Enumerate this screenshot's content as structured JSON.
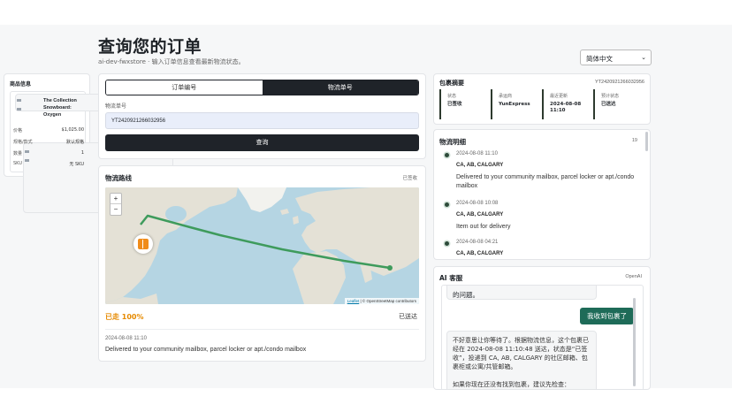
{
  "header": {
    "title": "查询您的订单",
    "subtitle": "ai-dev-fwxstore · 输入订单信息查看最新物流状态。",
    "language": "简体中文"
  },
  "product": {
    "section_title": "商品信息",
    "name": "The Collection Snowboard: Oxygen",
    "rows": [
      {
        "label": "价格",
        "value": "$1,025.00"
      },
      {
        "label": "规格/款式",
        "value": "默认规格"
      },
      {
        "label": "数量",
        "value": "1"
      },
      {
        "label": "SKU",
        "value": "无 SKU"
      }
    ]
  },
  "search": {
    "tabs": [
      "订单编号",
      "物流单号"
    ],
    "active_tab": "物流单号",
    "field_label": "物流单号",
    "field_value": "YT2420921266032956",
    "submit_label": "查询"
  },
  "route": {
    "title": "物流路线",
    "tag": "已签收",
    "attribution_link": "Leaflet",
    "attribution_text": " | © OpenStreetMap contributors",
    "progress_label": "已走 100%",
    "progress_fraction": 1.0,
    "status": "已送达",
    "last_event_time": "2024-08-08 11:10",
    "last_event_desc": "Delivered to your community mailbox, parcel locker or apt./condo mailbox"
  },
  "package": {
    "title": "包裹摘要",
    "tracking_no": "YT2420921266032956",
    "cells": [
      {
        "label": "状态",
        "value": "已签收"
      },
      {
        "label": "承运商",
        "value": "YunExpress"
      },
      {
        "label": "最近更新",
        "value": "2024-08-08\n11:10"
      },
      {
        "label": "预计状态",
        "value": "已送达"
      }
    ]
  },
  "details": {
    "title": "物流明细",
    "count": "19",
    "events": [
      {
        "time": "2024-08-08 11:10",
        "location": "CA, AB, CALGARY",
        "desc": "Delivered to your community mailbox, parcel locker or apt./condo mailbox"
      },
      {
        "time": "2024-08-08 10:08",
        "location": "CA, AB, CALGARY",
        "desc": "Item out for delivery"
      },
      {
        "time": "2024-08-08 04:21",
        "location": "CA, AB, CALGARY",
        "desc": ""
      }
    ]
  },
  "ai": {
    "title": "AI 客服",
    "provider": "OpenAI",
    "messages": [
      {
        "role": "assistant",
        "text": "的问题。"
      },
      {
        "role": "user",
        "text": "我收到包裹了"
      },
      {
        "role": "assistant",
        "text": "不好意思让你等待了。根据物流信息，这个包裹已经在 2024-08-08 11:10:48 送达，状态是“已签收”，投递到 CA, AB, CALGARY 的社区邮箱、包裹柜或公寓/共管邮箱。",
        "text2": "如果你现在还没有找到包裹，建议先检查："
      }
    ]
  },
  "colors": {
    "dark": "#1f2329",
    "accent_orange": "#e68a00",
    "route_green": "#3e9b5c",
    "chat_user": "#1e6b58"
  }
}
